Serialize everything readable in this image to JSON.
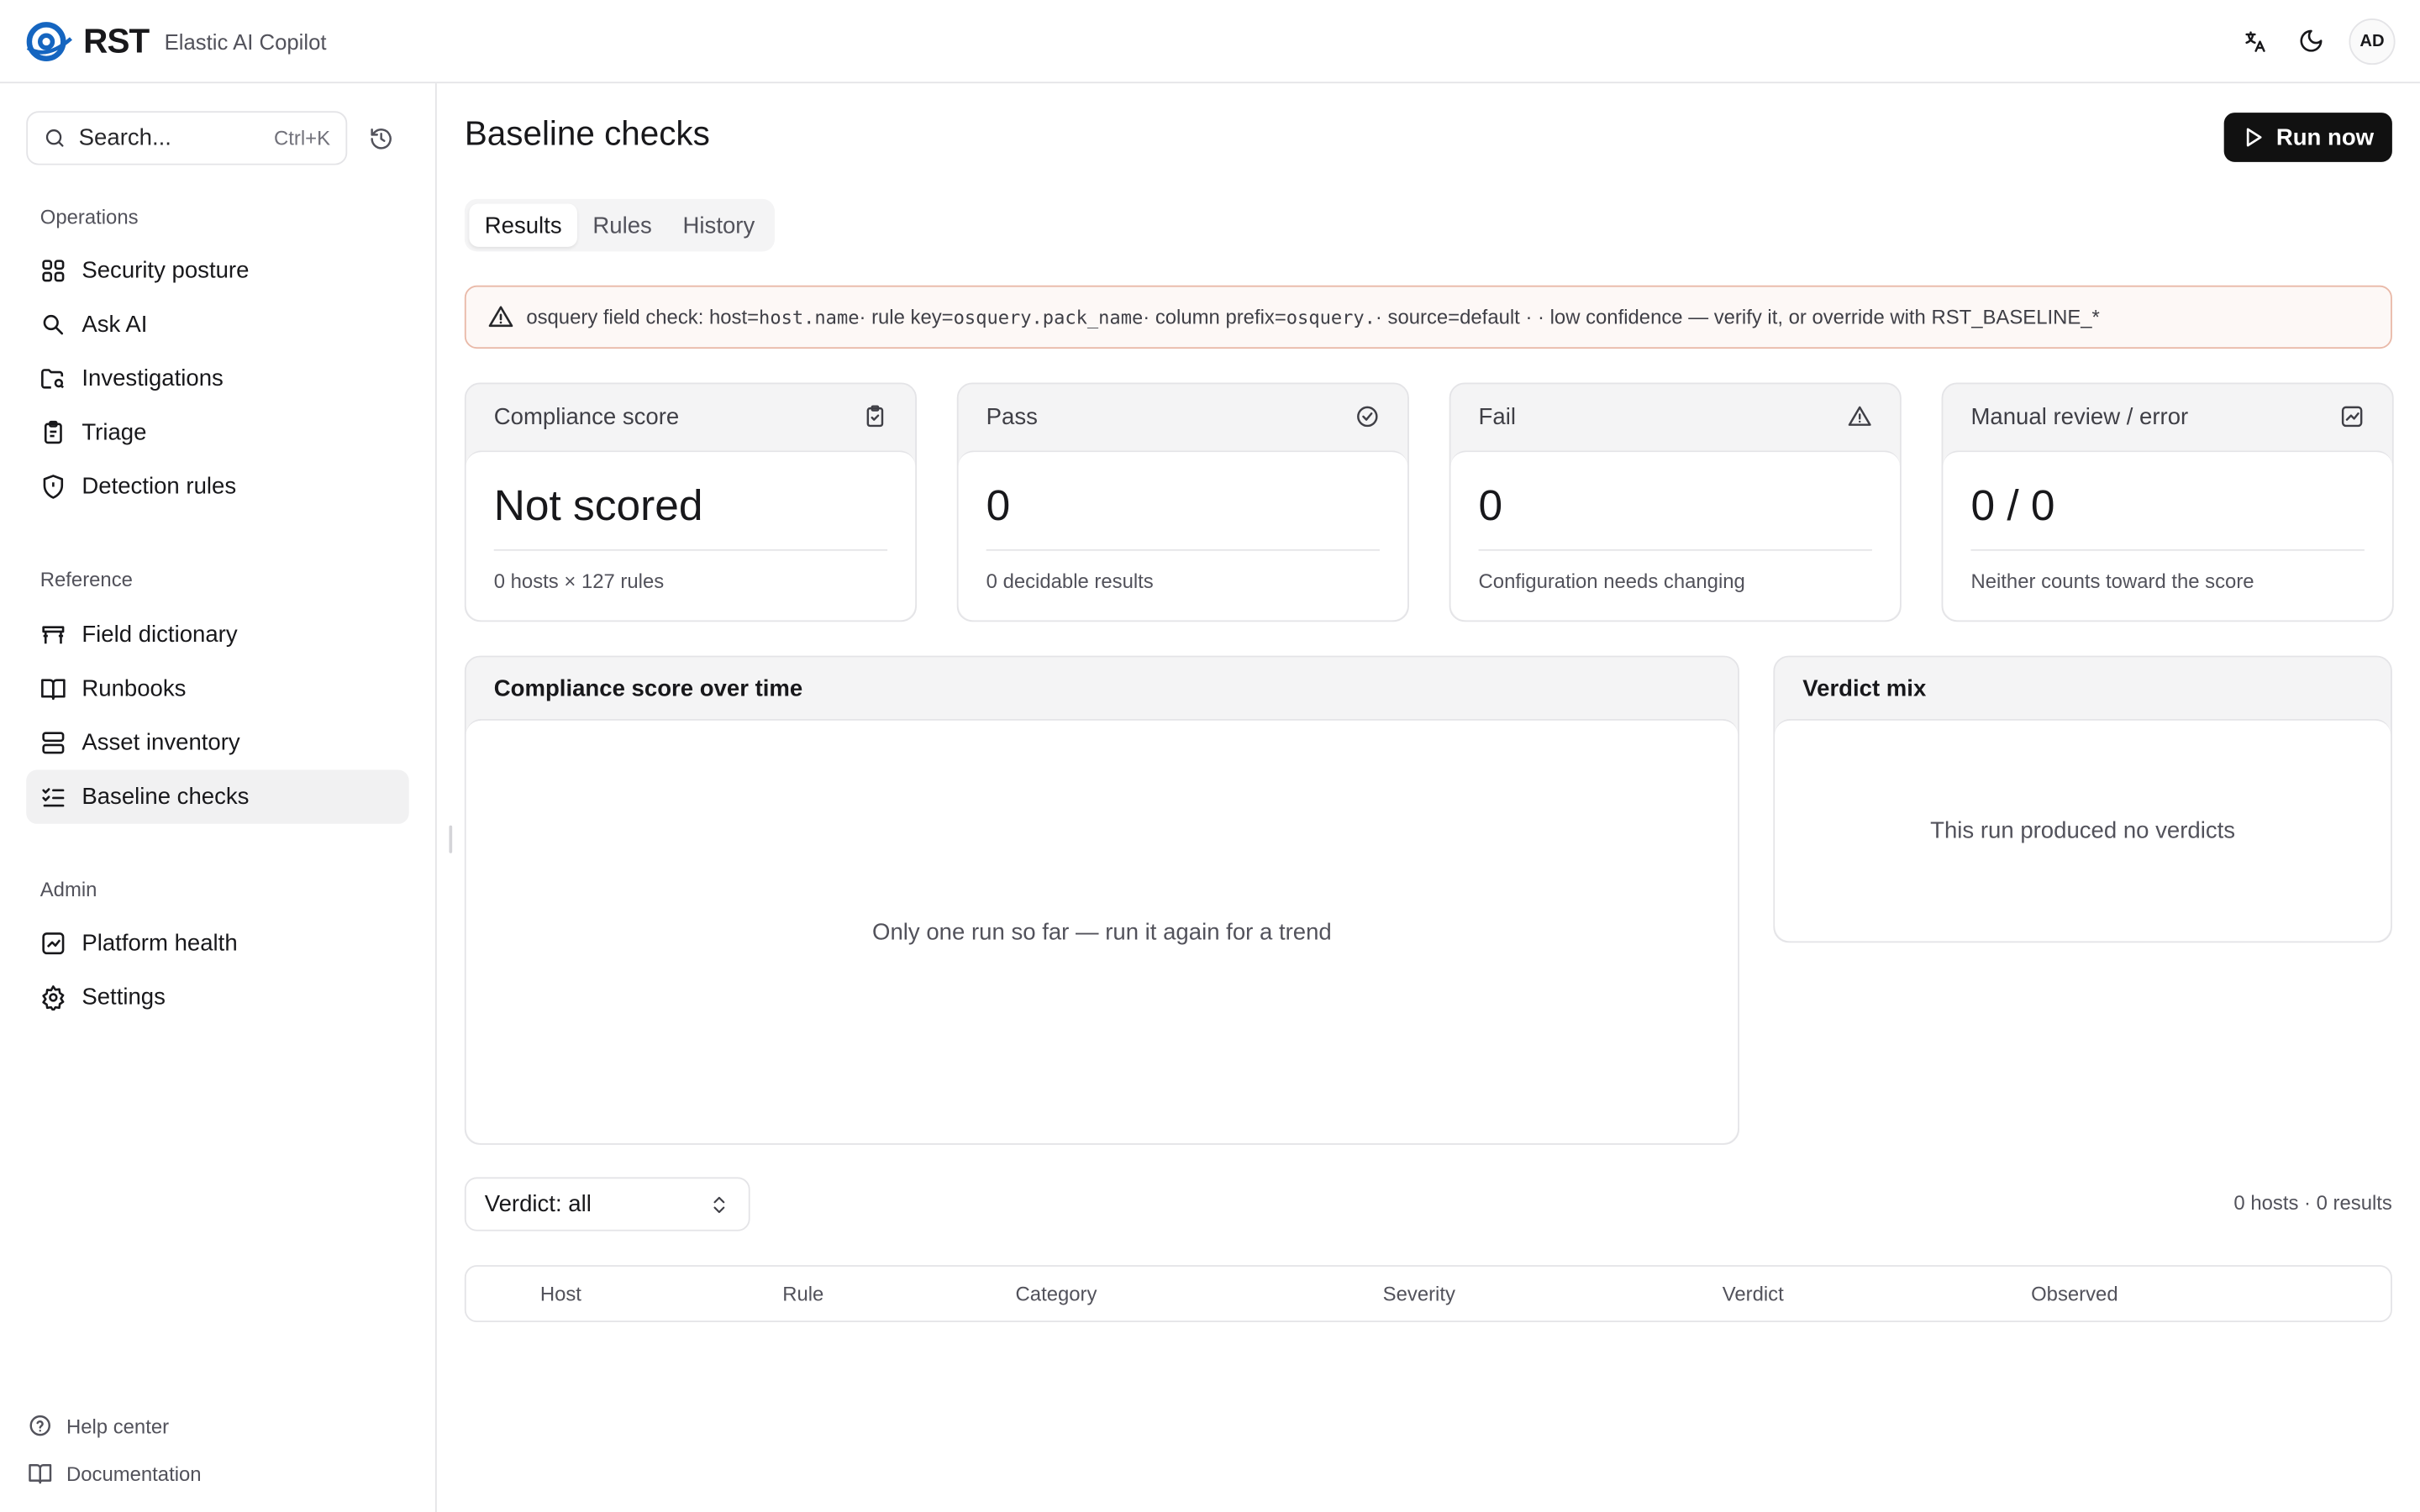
{
  "brand": {
    "logo_text": "RST",
    "app_name": "Elastic AI Copilot"
  },
  "topbar": {
    "avatar_initials": "AD",
    "icons": [
      "translate-icon",
      "moon-icon"
    ]
  },
  "sidebar": {
    "search_placeholder": "Search...",
    "search_shortcut": "Ctrl+K",
    "sections": [
      {
        "label": "Operations"
      },
      {
        "label": "Reference"
      },
      {
        "label": "Admin"
      }
    ],
    "items": [
      {
        "label": "Security posture",
        "icon": "grid-icon"
      },
      {
        "label": "Ask AI",
        "icon": "search-icon"
      },
      {
        "label": "Investigations",
        "icon": "folder-search-icon"
      },
      {
        "label": "Triage",
        "icon": "clipboard-icon"
      },
      {
        "label": "Detection rules",
        "icon": "shield-icon"
      },
      {
        "label": "Field dictionary",
        "icon": "table-icon"
      },
      {
        "label": "Runbooks",
        "icon": "book-icon"
      },
      {
        "label": "Asset inventory",
        "icon": "server-icon"
      },
      {
        "label": "Baseline checks",
        "icon": "list-checks-icon",
        "active": true
      },
      {
        "label": "Platform health",
        "icon": "chart-icon"
      },
      {
        "label": "Settings",
        "icon": "gear-icon"
      }
    ],
    "footer": [
      {
        "label": "Help center",
        "icon": "help-icon"
      },
      {
        "label": "Documentation",
        "icon": "book-open-icon"
      }
    ]
  },
  "page": {
    "title": "Baseline checks",
    "run_button": "Run now",
    "tabs": [
      {
        "label": "Results",
        "active": true
      },
      {
        "label": "Rules"
      },
      {
        "label": "History"
      }
    ]
  },
  "alert": {
    "p1": "osquery field check: host=",
    "host": "host.name",
    "p2": " · rule key=",
    "rule_key": "osquery.pack_name",
    "p3": " · column prefix=",
    "prefix": "osquery.",
    "p4": " · source=default · · low confidence — verify it, or override with RST_BASELINE_*"
  },
  "stats": [
    {
      "title": "Compliance score",
      "value": "Not scored",
      "sub": "0 hosts × 127 rules",
      "icon": "clipboard-check-icon"
    },
    {
      "title": "Pass",
      "value": "0",
      "sub": "0 decidable results",
      "icon": "check-circle-icon"
    },
    {
      "title": "Fail",
      "value": "0",
      "sub": "Configuration needs changing",
      "icon": "warning-icon"
    },
    {
      "title": "Manual review / error",
      "value": "0 / 0",
      "sub": "Neither counts toward the score",
      "icon": "trend-icon"
    }
  ],
  "trend_panel": {
    "title": "Compliance score over time",
    "empty": "Only one run so far — run it again for a trend"
  },
  "verdict_panel": {
    "title": "Verdict mix",
    "empty": "This run produced no verdicts"
  },
  "filter": {
    "verdict_value": "Verdict: all"
  },
  "results_count": "0 hosts · 0 results",
  "table": {
    "columns": [
      "Host",
      "Rule",
      "Category",
      "Severity",
      "Verdict",
      "Observed"
    ]
  },
  "colors": {
    "accent": "#1565c0",
    "primary_button": "#111111",
    "alert_border": "#e9b9a8"
  }
}
